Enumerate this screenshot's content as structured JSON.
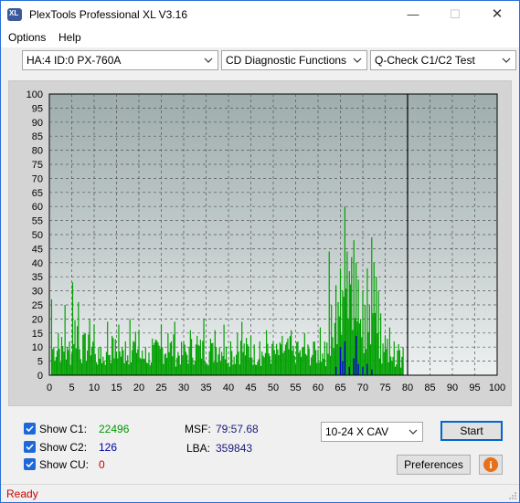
{
  "window": {
    "title": "PlexTools Professional XL V3.16",
    "minimize_glyph": "—",
    "maximize_glyph": "☐",
    "close_glyph": "✕",
    "icon": "plextools-logo-icon",
    "icon_text": "XL"
  },
  "menu": {
    "items": [
      "Options",
      "Help"
    ]
  },
  "toolbar": {
    "drive_select": "HA:4 ID:0  PX-760A",
    "function_select": "CD Diagnostic Functions",
    "test_select": "Q-Check C1/C2 Test"
  },
  "chart_data": {
    "type": "bar",
    "title": "",
    "xlabel": "",
    "ylabel": "",
    "xlim": [
      0,
      100
    ],
    "ylim": [
      0,
      100
    ],
    "x_ticks": [
      0,
      5,
      10,
      15,
      20,
      25,
      30,
      35,
      40,
      45,
      50,
      55,
      60,
      65,
      70,
      75,
      80,
      85,
      90,
      95,
      100
    ],
    "y_ticks": [
      0,
      5,
      10,
      15,
      20,
      25,
      30,
      35,
      40,
      45,
      50,
      55,
      60,
      65,
      70,
      75,
      80,
      85,
      90,
      95,
      100
    ],
    "grid": true,
    "test_end_marker_x": 80,
    "colors": {
      "plot_background": "#a9b6b6",
      "c1": "#00a000",
      "c2": "#0000cc"
    },
    "series": [
      {
        "name": "C1",
        "x": [
          0.5,
          2,
          3.5,
          4.5,
          5.2,
          6.5,
          8,
          9,
          10,
          11.5,
          13,
          14,
          15.5,
          17,
          18,
          20,
          21.5,
          23,
          25,
          26.5,
          28,
          30,
          31.5,
          33,
          34.5,
          36,
          37,
          39,
          40.5,
          42,
          43,
          45,
          47,
          48.5,
          50,
          52,
          54,
          55.5,
          57,
          59,
          60.5,
          61.5,
          62.5,
          63,
          64,
          64.5,
          65,
          65.5,
          66,
          66.5,
          67,
          67.5,
          68,
          68.5,
          69,
          69.5,
          70,
          70.5,
          71,
          71.5,
          72,
          72.5,
          73,
          73.5,
          74,
          75,
          76,
          77,
          78,
          79
        ],
        "values": [
          27,
          15,
          25,
          12,
          33,
          26,
          15,
          20,
          18,
          10,
          19,
          14,
          18,
          12,
          20,
          16,
          10,
          13,
          18,
          15,
          19,
          12,
          16,
          14,
          20,
          13,
          16,
          18,
          12,
          15,
          19,
          14,
          12,
          16,
          12,
          14,
          16,
          12,
          15,
          12,
          17,
          12,
          44,
          25,
          32,
          26,
          38,
          30,
          60,
          44,
          37,
          42,
          48,
          40,
          34,
          20,
          30,
          25,
          38,
          25,
          49,
          40,
          35,
          30,
          22,
          14,
          17,
          12,
          11,
          10
        ]
      },
      {
        "name": "C2",
        "x": [
          64,
          65,
          65.5,
          66,
          67,
          68,
          68.5,
          69,
          70,
          71,
          72
        ],
        "values": [
          3,
          10,
          5,
          12,
          3,
          6,
          14,
          4,
          3,
          4,
          2
        ]
      }
    ]
  },
  "options": {
    "show_c1": {
      "label": "Show C1:",
      "checked": true,
      "value": "22496",
      "value_color": "#009900"
    },
    "show_c2": {
      "label": "Show C2:",
      "checked": true,
      "value": "126",
      "value_color": "#0000aa"
    },
    "show_cu": {
      "label": "Show CU:",
      "checked": true,
      "value": "0",
      "value_color": "#cc0000"
    }
  },
  "info": {
    "msf_label": "MSF:",
    "msf_value": "79:57.68",
    "lba_label": "LBA:",
    "lba_value": "359843"
  },
  "speed_select": "10-24 X CAV",
  "buttons": {
    "start": "Start",
    "preferences": "Preferences",
    "info_glyph": "i"
  },
  "status": {
    "text": "Ready"
  }
}
